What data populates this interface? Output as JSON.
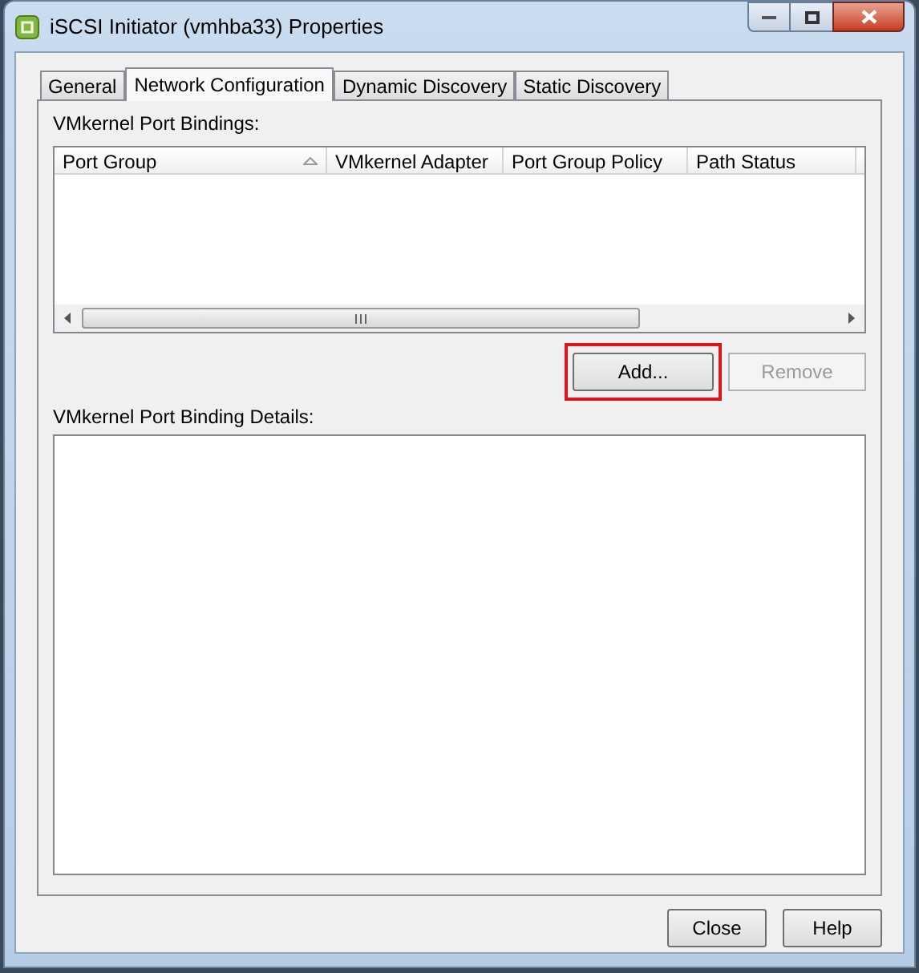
{
  "window": {
    "title": "iSCSI Initiator (vmhba33) Properties"
  },
  "tabs": [
    {
      "label": "General",
      "selected": false
    },
    {
      "label": "Network Configuration",
      "selected": true
    },
    {
      "label": "Dynamic Discovery",
      "selected": false
    },
    {
      "label": "Static Discovery",
      "selected": false
    }
  ],
  "bindings": {
    "label": "VMkernel Port Bindings:",
    "columns": [
      "Port Group",
      "VMkernel Adapter",
      "Port Group Policy",
      "Path Status"
    ],
    "buttons": [
      {
        "label": "Add...",
        "disabled": false,
        "highlighted": true
      },
      {
        "label": "Remove",
        "disabled": true,
        "highlighted": false
      }
    ]
  },
  "details": {
    "label": "VMkernel Port Binding Details:"
  },
  "footer_buttons": [
    "Close",
    "Help"
  ]
}
